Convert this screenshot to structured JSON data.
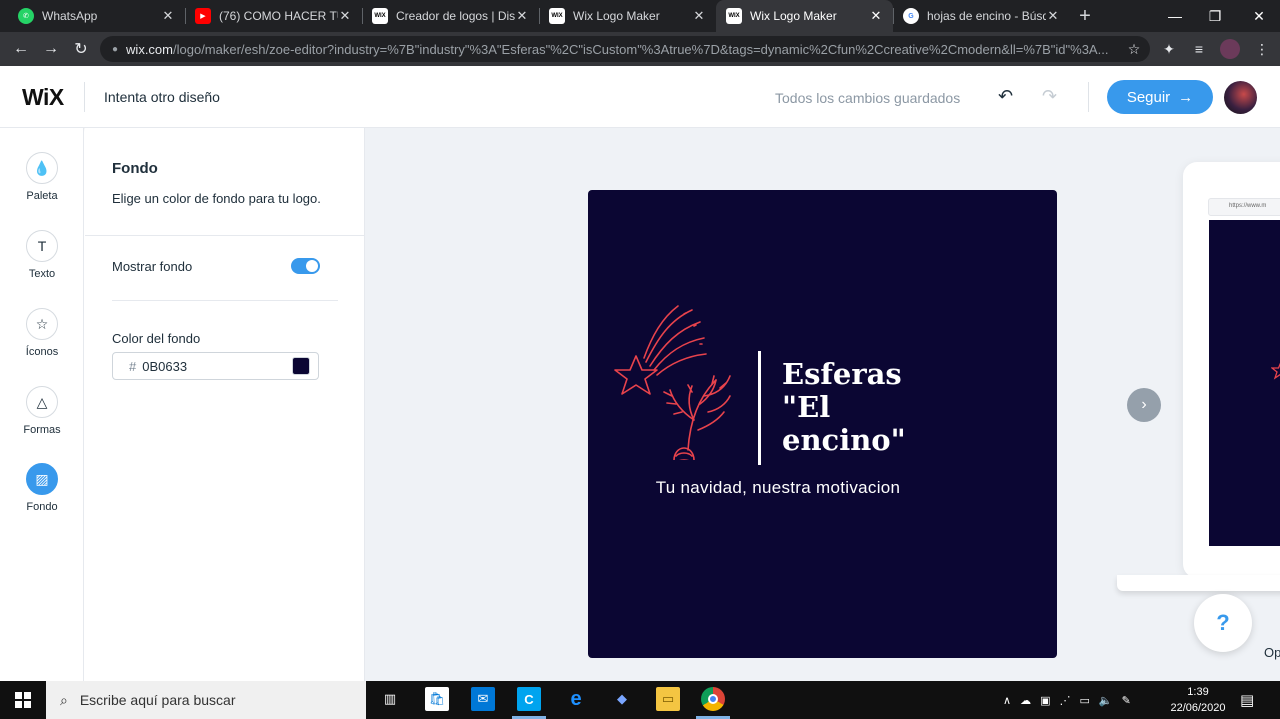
{
  "browser": {
    "tabs": [
      {
        "label": "WhatsApp",
        "favicon": "whatsapp-icon",
        "fav_color": "#25d366",
        "fav_text": "✆"
      },
      {
        "label": "(76) COMO HACER TU L",
        "favicon": "youtube-icon",
        "fav_color": "#ff0000",
        "fav_text": "▶"
      },
      {
        "label": "Creador de logos | Dise",
        "favicon": "wix-icon",
        "fav_color": "#ffffff",
        "fav_text": "WIX"
      },
      {
        "label": "Wix Logo Maker",
        "favicon": "wix-icon",
        "fav_color": "#ffffff",
        "fav_text": "WIX"
      },
      {
        "label": "Wix Logo Maker",
        "favicon": "wix-icon",
        "fav_color": "#ffffff",
        "fav_text": "WIX",
        "active": true
      },
      {
        "label": "hojas de encino - Búsq",
        "favicon": "google-icon",
        "fav_color": "#ffffff",
        "fav_text": "G"
      }
    ],
    "close_glyph": "✕",
    "newtab_glyph": "+",
    "window": {
      "minimize": "—",
      "maximize": "❐",
      "close": "✕"
    },
    "url_host": "wix.com",
    "url_path": "/logo/maker/esh/zoe-editor?industry=%7B\"industry\"%3A\"Esferas\"%2C\"isCustom\"%3Atrue%7D&tags=dynamic%2Cfun%2Ccreative%2Cmodern&ll=%7B\"id\"%3A...",
    "nav": {
      "back": "←",
      "forward": "→",
      "reload": "↻",
      "lock": "🔒",
      "star": "☆",
      "ext": "✦",
      "menu": "⋮",
      "media": "≡"
    }
  },
  "header": {
    "logo": "WiX",
    "try_design": "Intenta otro diseño",
    "saved_status": "Todos los cambios guardados",
    "undo": "↶",
    "redo": "↷",
    "next_label": "Seguir",
    "next_arrow": "→"
  },
  "rail": [
    {
      "label": "Paleta",
      "icon": "palette-icon",
      "glyph": "💧"
    },
    {
      "label": "Texto",
      "icon": "text-icon",
      "glyph": "T"
    },
    {
      "label": "Íconos",
      "icon": "star-icon",
      "glyph": "☆"
    },
    {
      "label": "Formas",
      "icon": "shapes-icon",
      "glyph": "△"
    },
    {
      "label": "Fondo",
      "icon": "background-icon",
      "glyph": "▨",
      "active": true
    }
  ],
  "panel": {
    "title": "Fondo",
    "subtitle": "Elige un color de fondo para tu logo.",
    "show_bg_label": "Mostrar fondo",
    "show_bg_on": true,
    "color_label": "Color del fondo",
    "hash": "#",
    "color_value": "0B0633"
  },
  "logo": {
    "bg_color": "#0b0633",
    "accent_color": "#e8434c",
    "brand_line1": "Esferas",
    "brand_line2": "\"El",
    "brand_line3": "encino\"",
    "tagline": "Tu navidad, nuestra motivacion"
  },
  "preview": {
    "next_glyph": "›",
    "mock_url": "https://www.m",
    "help_glyph": "?",
    "partial_label": "Op"
  },
  "accent": "#3899ec",
  "taskbar": {
    "search_placeholder": "Escribe aquí para buscar",
    "time": "1:39",
    "date": "22/06/2020"
  }
}
